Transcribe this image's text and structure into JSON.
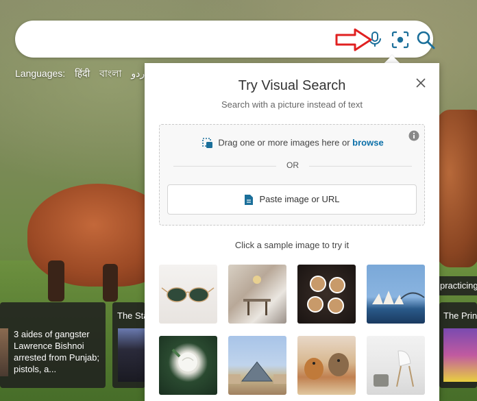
{
  "search": {
    "value": "",
    "icons": [
      "microphone-icon",
      "visual-search-icon",
      "search-icon"
    ]
  },
  "annotation": {
    "arrow_color": "#e02020"
  },
  "languages": {
    "label": "Languages:",
    "items": [
      "हिंदी",
      "বাংলা",
      "اردو",
      "ੰ"
    ]
  },
  "news": [
    {
      "title": "",
      "text": "3 aides of gangster Lawrence Bishnoi arrested from Punjab; pistols, a..."
    },
    {
      "title": "The Sta",
      "text": ""
    },
    {
      "title": "practicing",
      "text": ""
    },
    {
      "title": "The Prin",
      "text": ""
    }
  ],
  "visual_search": {
    "title": "Try Visual Search",
    "subtitle": "Search with a picture instead of text",
    "drag_text": "Drag one or more images here or",
    "browse": "browse",
    "or": "OR",
    "paste": "Paste image or URL",
    "sample_label": "Click a sample image to try it",
    "samples": [
      "sunglasses",
      "dining room",
      "coffee cups",
      "sydney opera house",
      "white rose",
      "louvre pyramid",
      "dogs",
      "white chair"
    ]
  },
  "colors": {
    "accent": "#0a6fa8",
    "icon": "#1b6f9a"
  }
}
